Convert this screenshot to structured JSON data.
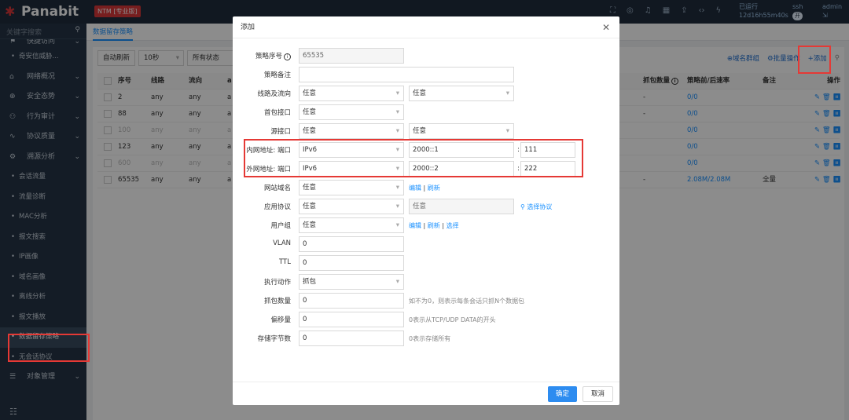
{
  "header": {
    "logo_text": "Panabit",
    "edition_badge": "NTM [专业版]",
    "uptime_label": "已运行",
    "uptime_value": "12d16h55m40s",
    "ssh_label": "ssh",
    "ssh_toggle": "开",
    "user": "admin"
  },
  "sidebar": {
    "search_placeholder": "关键字搜索",
    "items": [
      {
        "label": "快捷访问",
        "type": "group"
      },
      {
        "label": "奇安信威胁...",
        "type": "sub"
      },
      {
        "label": "网络概况",
        "type": "group",
        "icon": "home-icon"
      },
      {
        "label": "安全态势",
        "type": "group",
        "icon": "globe-icon"
      },
      {
        "label": "行为审计",
        "type": "group",
        "icon": "user-icon"
      },
      {
        "label": "协议质量",
        "type": "group",
        "icon": "pulse-icon"
      },
      {
        "label": "溯源分析",
        "type": "group",
        "icon": "gear-icon"
      },
      {
        "label": "会话流量",
        "type": "sub"
      },
      {
        "label": "流量诊断",
        "type": "sub"
      },
      {
        "label": "MAC分析",
        "type": "sub"
      },
      {
        "label": "报文搜索",
        "type": "sub"
      },
      {
        "label": "IP画像",
        "type": "sub"
      },
      {
        "label": "域名画像",
        "type": "sub"
      },
      {
        "label": "离线分析",
        "type": "sub"
      },
      {
        "label": "报文播放",
        "type": "sub"
      },
      {
        "label": "数据留存策略",
        "type": "sub",
        "active": true
      },
      {
        "label": "无会话协议",
        "type": "sub"
      },
      {
        "label": "对象管理",
        "type": "group",
        "icon": "database-icon"
      }
    ]
  },
  "tab": {
    "label": "数据留存策略"
  },
  "toolbar": {
    "auto_refresh": "自动刷新",
    "interval": "10秒",
    "status": "所有状态",
    "domain_group": "域名群组",
    "batch": "批量操作",
    "add": "添加"
  },
  "table": {
    "headers": [
      "序号",
      "线路",
      "流向",
      "a",
      "抓包数量",
      "策略前/后速率",
      "备注",
      "操作"
    ],
    "rows": [
      {
        "id": "2",
        "line": "any",
        "dir": "any",
        "cut": "a",
        "cap": "-",
        "rate": "0/0",
        "note": "",
        "dim": false
      },
      {
        "id": "88",
        "line": "any",
        "dir": "any",
        "cut": "a",
        "cap": "-",
        "rate": "0/0",
        "note": "",
        "dim": false
      },
      {
        "id": "100",
        "line": "any",
        "dir": "any",
        "cut": "a",
        "cap": "",
        "rate": "0/0",
        "note": "",
        "dim": true
      },
      {
        "id": "123",
        "line": "any",
        "dir": "any",
        "cut": "a",
        "cap": "",
        "rate": "0/0",
        "note": "",
        "dim": false
      },
      {
        "id": "600",
        "line": "any",
        "dir": "any",
        "cut": "a",
        "cap": "",
        "rate": "0/0",
        "note": "",
        "dim": true
      },
      {
        "id": "65535",
        "line": "any",
        "dir": "any",
        "cut": "a",
        "cap": "-",
        "rate": "2.08M/2.08M",
        "note": "全量",
        "dim": false
      }
    ]
  },
  "dialog": {
    "title": "添加",
    "fields": {
      "policy_no_label": "策略序号",
      "policy_no_value": "65535",
      "note_label": "策略备注",
      "line_label": "线路及流向",
      "line_value": "任意",
      "dir_value": "任意",
      "first_if_label": "首包接口",
      "first_if_value": "任意",
      "src_if_label": "源接口",
      "src_if_value": "任意",
      "src_if_value2": "任意",
      "inner_label": "内网地址: 端口",
      "inner_type": "IPv6",
      "inner_addr": "2000::1",
      "inner_port": "111",
      "outer_label": "外网地址: 端口",
      "outer_type": "IPv6",
      "outer_addr": "2000::2",
      "outer_port": "222",
      "site_label": "网站域名",
      "site_value": "任意",
      "app_label": "应用协议",
      "app_value": "任意",
      "app_value2": "任意",
      "app_select_link": "选择协议",
      "usergroup_label": "用户组",
      "usergroup_value": "任意",
      "vlan_label": "VLAN",
      "vlan_value": "0",
      "ttl_label": "TTL",
      "ttl_value": "0",
      "action_label": "执行动作",
      "action_value": "抓包",
      "capcount_label": "抓包数量",
      "capcount_value": "0",
      "capcount_hint": "如不为0，则表示每条会话只抓N个数据包",
      "offset_label": "偏移量",
      "offset_value": "0",
      "offset_hint": "0表示从TCP/UDP DATA的开头",
      "bytes_label": "存储字节数",
      "bytes_value": "0",
      "bytes_hint": "0表示存储所有"
    },
    "links": {
      "edit": "编辑",
      "refresh": "刷新",
      "select": "选择",
      "divider": "|"
    },
    "ok": "确定",
    "cancel": "取消"
  },
  "colors": {
    "highlight": "#e53935",
    "accent": "#1890ff",
    "sidebar_bg": "#263445",
    "topbar_bg": "#1f2d3d"
  }
}
